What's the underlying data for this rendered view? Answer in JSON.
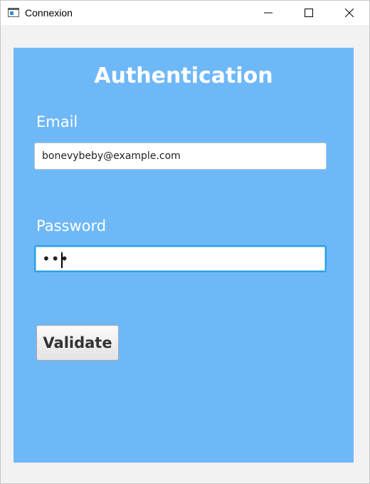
{
  "window": {
    "title": "Connexion"
  },
  "form": {
    "heading": "Authentication",
    "email_label": "Email",
    "email_value": "bonevybeby@example.com",
    "password_label": "Password",
    "password_mask": "•••",
    "validate_label": "Validate"
  },
  "colors": {
    "panel_background": "#6fb8f8",
    "focus_border": "#2aa1e3"
  },
  "icons": {
    "app": "app-window-icon",
    "minimize": "minimize-icon",
    "maximize": "maximize-icon",
    "close": "close-icon"
  }
}
